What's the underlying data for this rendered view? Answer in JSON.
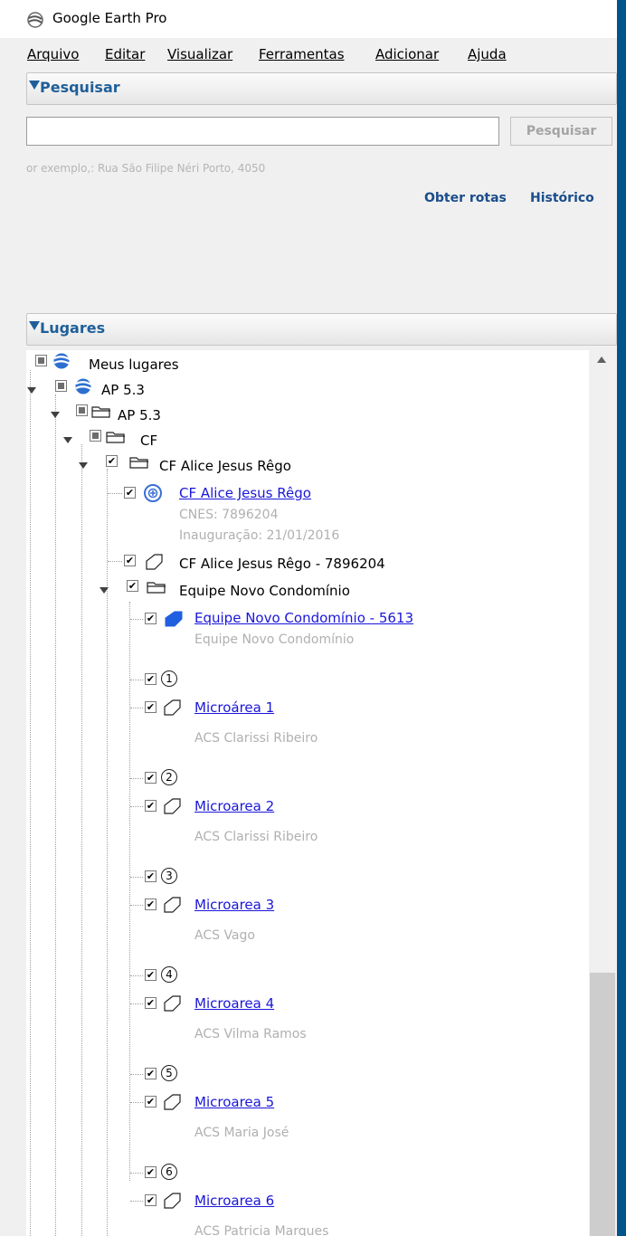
{
  "window": {
    "title": "Google Earth Pro"
  },
  "menu": [
    "Arquivo",
    "Editar",
    "Visualizar",
    "Ferramentas",
    "Adicionar",
    "Ajuda"
  ],
  "search_panel": {
    "header": "Pesquisar",
    "input_value": "",
    "button": "Pesquisar",
    "example": "or exemplo,: Rua São Filipe Néri Porto, 4050",
    "links": {
      "directions": "Obter rotas",
      "history": "Histórico"
    }
  },
  "places_panel": {
    "header": "Lugares",
    "tree": {
      "my_places": "Meus lugares",
      "ap_folder_1": "AP 5.3",
      "ap_folder_2": "AP 5.3",
      "cf_folder": "CF",
      "cf_alice_folder": "CF Alice Jesus Rêgo",
      "cf_alice_placemark": {
        "label": "CF Alice Jesus Rêgo",
        "desc1": "CNES: 7896204",
        "desc2": "Inauguração: 21/01/2016"
      },
      "cf_alice_polygon": "CF Alice Jesus Rêgo - 7896204",
      "team_folder": "Equipe Novo Condomínio",
      "team_polygon": {
        "label": "Equipe Novo Condomínio - 5613",
        "desc": "Equipe Novo Condomínio"
      },
      "microareas": [
        {
          "number": "1",
          "label": "Microárea 1",
          "desc": "ACS Clarissi Ribeiro"
        },
        {
          "number": "2",
          "label": "Microarea 2",
          "desc": "ACS Clarissi Ribeiro"
        },
        {
          "number": "3",
          "label": "Microarea 3",
          "desc": "ACS Vago"
        },
        {
          "number": "4",
          "label": "Microarea 4",
          "desc": "ACS Vilma Ramos"
        },
        {
          "number": "5",
          "label": "Microarea 5",
          "desc": "ACS Maria José"
        },
        {
          "number": "6",
          "label": "Microarea 6",
          "desc": "ACS Patricia Marques"
        }
      ]
    }
  },
  "colors": {
    "link": "#1a16d9",
    "header_text": "#1f5f99",
    "desktop": "#00558b"
  }
}
